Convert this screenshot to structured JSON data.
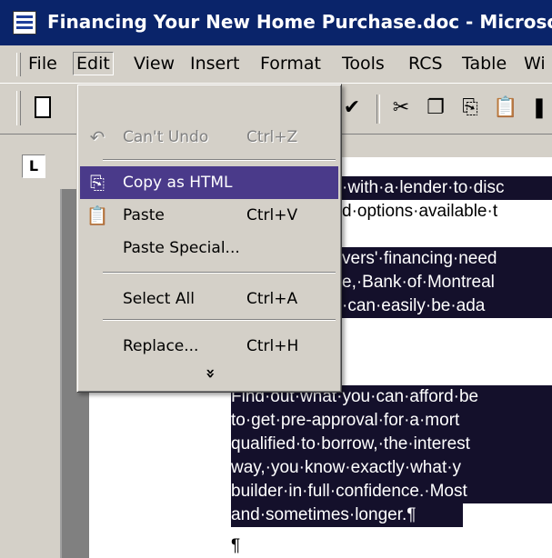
{
  "window": {
    "title": "Financing Your New Home Purchase.doc - Microso"
  },
  "menubar": {
    "items": [
      {
        "label": "File"
      },
      {
        "label": "Edit"
      },
      {
        "label": "View"
      },
      {
        "label": "Insert"
      },
      {
        "label": "Format"
      },
      {
        "label": "Tools"
      },
      {
        "label": "RCS"
      },
      {
        "label": "Table"
      },
      {
        "label": "Wi"
      }
    ]
  },
  "ruler": {
    "tab_selector": "L"
  },
  "edit_menu": {
    "undo": {
      "label": "Can't Undo",
      "shortcut": "Ctrl+Z"
    },
    "copy_html": {
      "label": "Copy as HTML"
    },
    "paste": {
      "label": "Paste",
      "shortcut": "Ctrl+V"
    },
    "paste_special": {
      "label": "Paste Special..."
    },
    "select_all": {
      "label": "Select All",
      "shortcut": "Ctrl+A"
    },
    "replace": {
      "label": "Replace...",
      "shortcut": "Ctrl+H"
    },
    "more": "»"
  },
  "document": {
    "line1": "·with·a·lender·to·disc",
    "line2": "d·options·available·t",
    "line3": "vers'·financing·need",
    "line4": "e,·Bank·of·Montreal",
    "line5": "·can·easily·be·ada",
    "para2": [
      "Find·out·what·you·can·afford·be",
      "to·get·pre-approval·for·a·mort",
      "qualified·to·borrow,·the·interest",
      "way,·you·know·exactly·what·y",
      "builder·in·full·confidence.·Most",
      "and·sometimes·longer.¶"
    ],
    "last": "¶"
  },
  "colors": {
    "selection": "#14102b",
    "menu_highlight": "#4a3a8a",
    "title_bar": "#0a246a"
  }
}
